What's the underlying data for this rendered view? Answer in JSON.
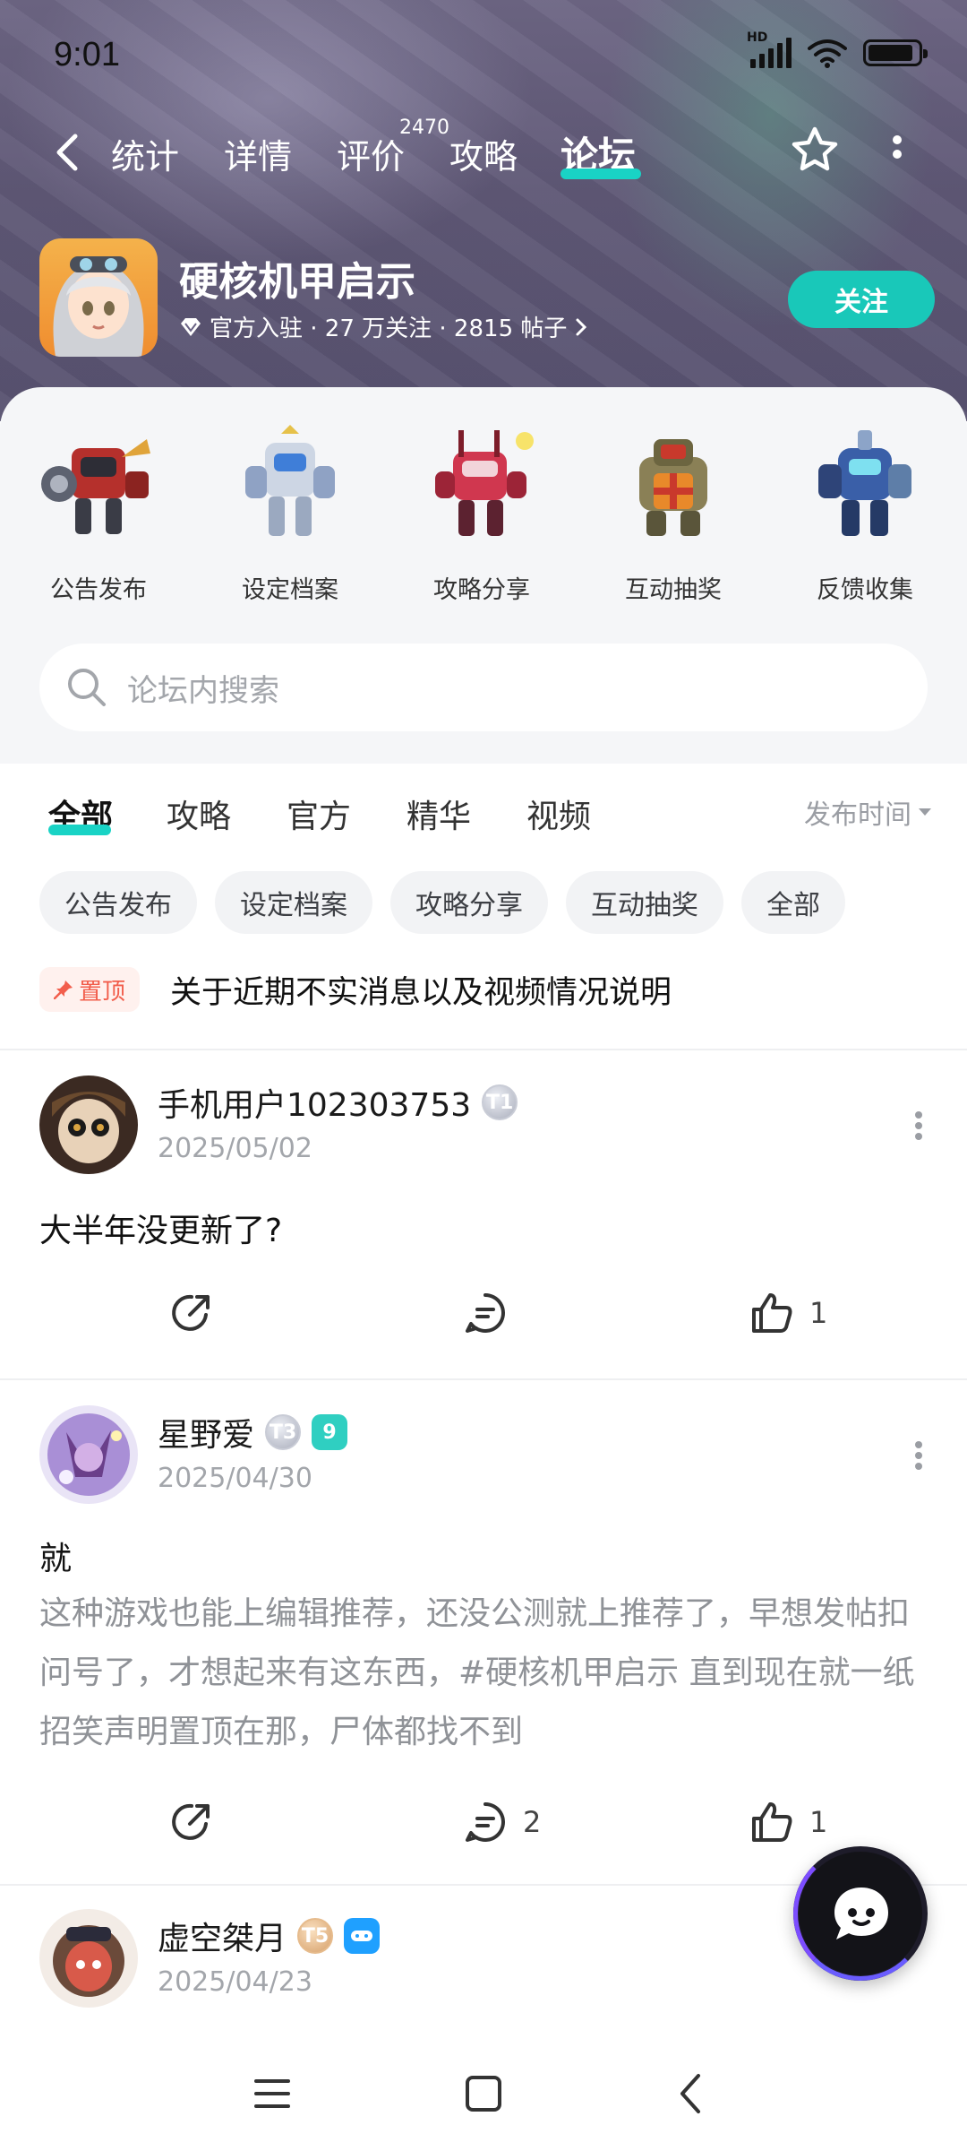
{
  "status_bar": {
    "time": "9:01",
    "network": "HD",
    "battery_level": 0.9
  },
  "nav": {
    "tabs": [
      {
        "label": "统计"
      },
      {
        "label": "详情"
      },
      {
        "label": "评价",
        "badge": "2470"
      },
      {
        "label": "攻略"
      },
      {
        "label": "论坛"
      }
    ],
    "active_tab": "论坛"
  },
  "game": {
    "name": "硬核机甲启示",
    "meta": "官方入驻 · 27 万关注 · 2815 帖子",
    "follow_label": "关注"
  },
  "categories": [
    {
      "label": "公告发布",
      "icon": "mecha-announcement-icon"
    },
    {
      "label": "设定档案",
      "icon": "mecha-archive-icon"
    },
    {
      "label": "攻略分享",
      "icon": "mecha-guide-icon"
    },
    {
      "label": "互动抽奖",
      "icon": "mecha-lottery-icon"
    },
    {
      "label": "反馈收集",
      "icon": "mecha-feedback-icon"
    }
  ],
  "search": {
    "placeholder": "论坛内搜索"
  },
  "filter_tabs": [
    {
      "label": "全部"
    },
    {
      "label": "攻略"
    },
    {
      "label": "官方"
    },
    {
      "label": "精华"
    },
    {
      "label": "视频"
    }
  ],
  "active_filter": "全部",
  "sort_label": "发布时间",
  "chips": [
    "公告发布",
    "设定档案",
    "攻略分享",
    "互动抽奖",
    "全部"
  ],
  "pinned": {
    "badge": "置顶",
    "title": "关于近期不实消息以及视频情况说明"
  },
  "posts": [
    {
      "user": "手机用户102303753",
      "level_badge": "T1",
      "date": "2025/05/02",
      "title": "大半年没更新了?",
      "body": "",
      "comments": "",
      "likes": "1"
    },
    {
      "user": "星野爱",
      "level_badge": "T3",
      "extra_badge": "9",
      "date": "2025/04/30",
      "title": "就",
      "body": "这种游戏也能上编辑推荐，还没公测就上推荐了，早想发帖扣问号了，才想起来有这东西，#硬核机甲启示 直到现在就一纸招笑声明置顶在那，尸体都找不到",
      "comments": "2",
      "likes": "1"
    },
    {
      "user": "虚空桀月",
      "level_badge": "T5",
      "date": "2025/04/23"
    }
  ],
  "colors": {
    "accent": "#19c8b9",
    "pin": "#f25e4c",
    "muted": "#a3a6ab"
  }
}
